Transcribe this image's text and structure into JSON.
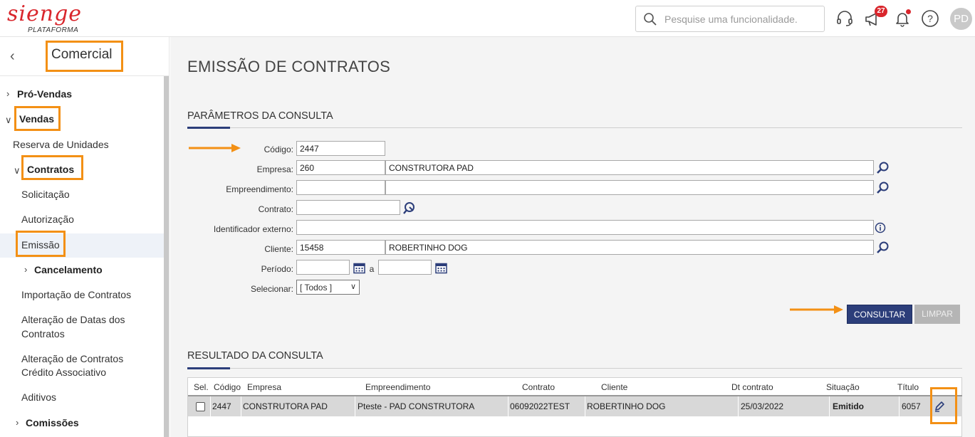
{
  "header": {
    "logo_text": "sienge",
    "logo_sub": "PLATAFORMA",
    "search_placeholder": "Pesquise uma funcionalidade.",
    "notifications_count": "27",
    "avatar_initials": "PD",
    "icons": [
      "headset-icon",
      "megaphone-icon",
      "bell-icon",
      "help-icon"
    ]
  },
  "sidebar": {
    "title": "Comercial",
    "items": [
      {
        "label": "Pró-Vendas"
      },
      {
        "label": "Vendas"
      },
      {
        "label": "Reserva de Unidades"
      },
      {
        "label": "Contratos"
      },
      {
        "label": "Solicitação"
      },
      {
        "label": "Autorização"
      },
      {
        "label": "Emissão"
      },
      {
        "label": "Cancelamento"
      },
      {
        "label": "Importação de Contratos"
      },
      {
        "label": "Alteração de Datas dos"
      },
      {
        "label": "Contratos"
      },
      {
        "label": "Alteração de Contratos"
      },
      {
        "label": "Crédito Associativo"
      },
      {
        "label": "Aditivos"
      },
      {
        "label": "Comissões"
      }
    ]
  },
  "page": {
    "title": "EMISSÃO DE CONTRATOS",
    "params_title": "PARÂMETROS DA CONSULTA",
    "results_title": "RESULTADO DA CONSULTA"
  },
  "form": {
    "codigo": {
      "label": "Código:",
      "value": "2447"
    },
    "empresa": {
      "label": "Empresa:",
      "code": "260",
      "name": "CONSTRUTORA PAD"
    },
    "empreendimento": {
      "label": "Empreendimento:",
      "code": "",
      "name": ""
    },
    "contrato": {
      "label": "Contrato:",
      "value": ""
    },
    "identificador": {
      "label": "Identificador externo:",
      "value": ""
    },
    "cliente": {
      "label": "Cliente:",
      "code": "15458",
      "name": "ROBERTINHO DOG"
    },
    "periodo": {
      "label": "Período:",
      "from": "",
      "sep": "a",
      "to": ""
    },
    "selecionar": {
      "label": "Selecionar:",
      "value": "[ Todos ]"
    }
  },
  "buttons": {
    "consultar": "CONSULTAR",
    "limpar": "LIMPAR"
  },
  "table": {
    "columns": [
      "Sel.",
      "Código",
      "Empresa",
      "Empreendimento",
      "Contrato",
      "Cliente",
      "Dt contrato",
      "Situação",
      "Título"
    ],
    "rows": [
      {
        "codigo": "2447",
        "empresa": "CONSTRUTORA PAD",
        "empreendimento": "Pteste - PAD CONSTRUTORA",
        "contrato": "06092022TEST",
        "cliente": "ROBERTINHO DOG",
        "dt_contrato": "25/03/2022",
        "situacao": "Emitido",
        "titulo": "6057"
      }
    ]
  },
  "colors": {
    "brand_red": "#d9262c",
    "primary_blue": "#2c3e7a",
    "annotation_orange": "#f39015"
  }
}
